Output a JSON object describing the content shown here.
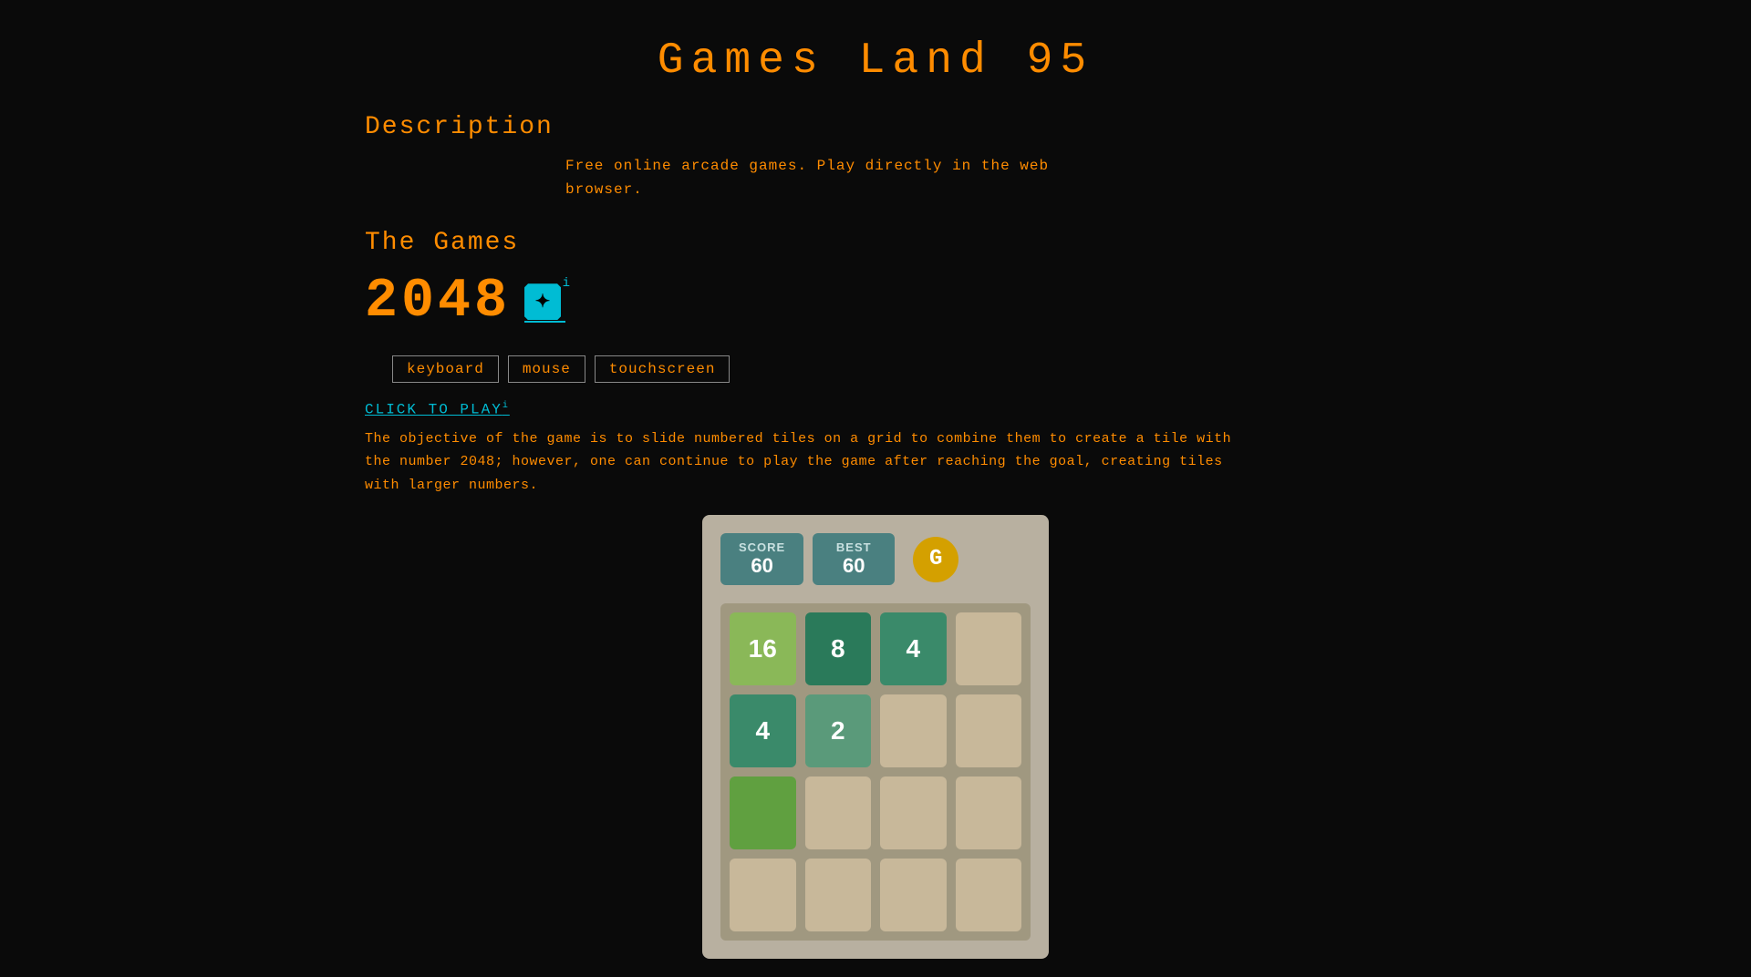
{
  "site": {
    "title": "Games Land 95"
  },
  "description": {
    "heading": "Description",
    "text_line1": "Free online arcade games. Play directly in the web",
    "text_line2": "browser."
  },
  "games": {
    "heading": "The Games",
    "game_title": "2048",
    "input_methods": [
      "keyboard",
      "mouse",
      "touchscreen"
    ],
    "click_to_play": "CLICK TO PLAY",
    "game_description": "The objective of the game is to slide numbered tiles on a grid to combine them to create a tile with the number 2048; however, one can continue to play the game after reaching the goal, creating tiles with larger numbers.",
    "score_label": "SCORE",
    "best_label": "BEST",
    "score_value": "60",
    "best_value": "60",
    "grid": {
      "rows": [
        [
          16,
          8,
          4,
          null
        ],
        [
          4,
          2,
          null,
          null
        ],
        [
          null,
          null,
          null,
          null
        ],
        [
          null,
          null,
          null,
          null
        ]
      ]
    }
  }
}
